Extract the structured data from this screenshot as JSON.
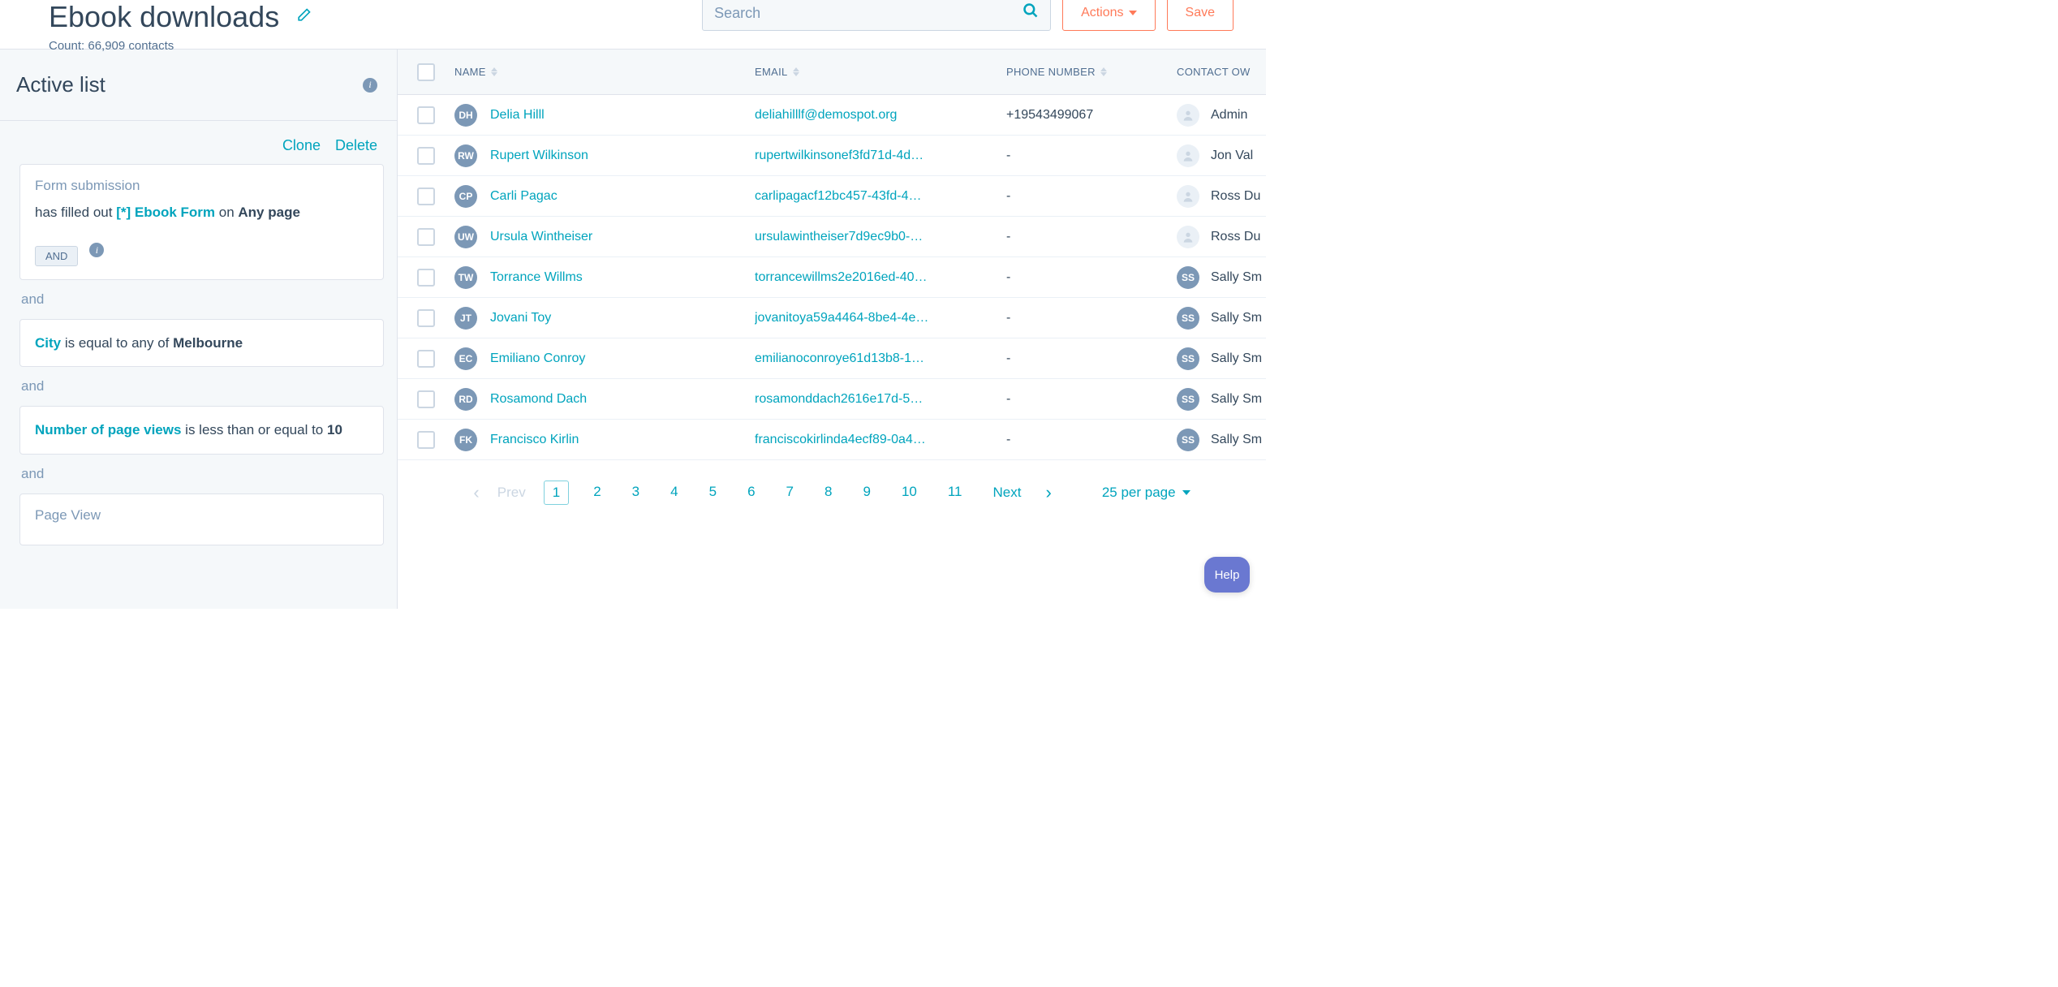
{
  "header": {
    "title": "Ebook downloads",
    "count_label": "Count: 66,909 contacts",
    "search_placeholder": "Search",
    "actions_label": "Actions",
    "save_label": "Save"
  },
  "sidebar": {
    "active_list_label": "Active list",
    "clone_label": "Clone",
    "delete_label": "Delete",
    "and_label": "and",
    "and_pill": "AND",
    "filters": [
      {
        "label": "Form submission",
        "prefix": "has filled out ",
        "link": "[*] Ebook Form",
        "mid": " on ",
        "bold": "Any page",
        "show_and_pill": true
      },
      {
        "label": "",
        "prefix": "",
        "link": "City",
        "mid": " is equal to any of ",
        "bold": "Melbourne",
        "show_and_pill": false
      },
      {
        "label": "",
        "prefix": "",
        "link": "Number of page views",
        "mid": " is less than or equal to ",
        "bold": "10",
        "show_and_pill": false
      },
      {
        "label": "Page View",
        "prefix": "",
        "link": "",
        "mid": "",
        "bold": "",
        "show_and_pill": false
      }
    ]
  },
  "table": {
    "columns": {
      "name": "NAME",
      "email": "EMAIL",
      "phone": "PHONE NUMBER",
      "owner": "CONTACT OW"
    },
    "rows": [
      {
        "initials": "DH",
        "name": "Delia Hilll",
        "email": "deliahilllf@demospot.org",
        "phone": "+19543499067",
        "owner": "Admin ",
        "owner_avatar_type": "light"
      },
      {
        "initials": "RW",
        "name": "Rupert Wilkinson",
        "email": "rupertwilkinsonef3fd71d-4d…",
        "phone": "-",
        "owner": "Jon Val",
        "owner_avatar_type": "light"
      },
      {
        "initials": "CP",
        "name": "Carli Pagac",
        "email": "carlipagacf12bc457-43fd-4…",
        "phone": "-",
        "owner": "Ross Du",
        "owner_avatar_type": "light"
      },
      {
        "initials": "UW",
        "name": "Ursula Wintheiser",
        "email": "ursulawintheiser7d9ec9b0-…",
        "phone": "-",
        "owner": "Ross Du",
        "owner_avatar_type": "light"
      },
      {
        "initials": "TW",
        "name": "Torrance Willms",
        "email": "torrancewillms2e2016ed-40…",
        "phone": "-",
        "owner": "Sally Sm",
        "owner_avatar_type": "ss"
      },
      {
        "initials": "JT",
        "name": "Jovani Toy",
        "email": "jovanitoya59a4464-8be4-4e…",
        "phone": "-",
        "owner": "Sally Sm",
        "owner_avatar_type": "ss"
      },
      {
        "initials": "EC",
        "name": "Emiliano Conroy",
        "email": "emilianoconroye61d13b8-1…",
        "phone": "-",
        "owner": "Sally Sm",
        "owner_avatar_type": "ss"
      },
      {
        "initials": "RD",
        "name": "Rosamond Dach",
        "email": "rosamonddach2616e17d-5…",
        "phone": "-",
        "owner": "Sally Sm",
        "owner_avatar_type": "ss"
      },
      {
        "initials": "FK",
        "name": "Francisco Kirlin",
        "email": "franciscokirlinda4ecf89-0a4…",
        "phone": "-",
        "owner": "Sally Sm",
        "owner_avatar_type": "ss"
      }
    ]
  },
  "pagination": {
    "prev": "Prev",
    "next": "Next",
    "pages": [
      "1",
      "2",
      "3",
      "4",
      "5",
      "6",
      "7",
      "8",
      "9",
      "10",
      "11"
    ],
    "current": "1",
    "per_page": "25 per page"
  },
  "help": {
    "label": "Help"
  }
}
